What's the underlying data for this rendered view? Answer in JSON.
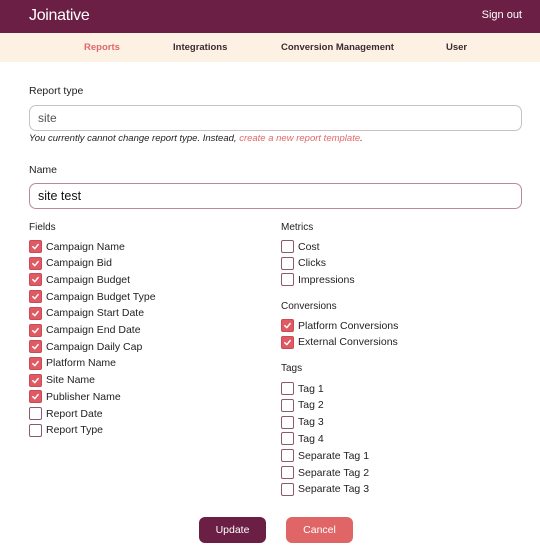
{
  "header": {
    "brand": "Joinative",
    "signout": "Sign out"
  },
  "nav": {
    "items": [
      {
        "label": "Reports",
        "active": true
      },
      {
        "label": "Integrations",
        "active": false
      },
      {
        "label": "Conversion Management",
        "active": false
      },
      {
        "label": "User",
        "active": false
      }
    ]
  },
  "form": {
    "report_type_label": "Report type",
    "report_type_value": "site",
    "hint_text": "You currently cannot change report type. Instead, ",
    "hint_link": "create a new report template",
    "hint_end": ".",
    "name_label": "Name",
    "name_value": "site test"
  },
  "fields": {
    "title": "Fields",
    "items": [
      {
        "label": "Campaign Name",
        "checked": true
      },
      {
        "label": "Campaign Bid",
        "checked": true
      },
      {
        "label": "Campaign Budget",
        "checked": true
      },
      {
        "label": "Campaign Budget Type",
        "checked": true
      },
      {
        "label": "Campaign Start Date",
        "checked": true
      },
      {
        "label": "Campaign End Date",
        "checked": true
      },
      {
        "label": "Campaign Daily Cap",
        "checked": true
      },
      {
        "label": "Platform Name",
        "checked": true
      },
      {
        "label": "Site Name",
        "checked": true
      },
      {
        "label": "Publisher Name",
        "checked": true
      },
      {
        "label": "Report Date",
        "checked": false
      },
      {
        "label": "Report Type",
        "checked": false
      }
    ]
  },
  "metrics": {
    "title": "Metrics",
    "items": [
      {
        "label": "Cost",
        "checked": false
      },
      {
        "label": "Clicks",
        "checked": false
      },
      {
        "label": "Impressions",
        "checked": false
      }
    ]
  },
  "conversions": {
    "title": "Conversions",
    "items": [
      {
        "label": "Platform Conversions",
        "checked": true
      },
      {
        "label": "External Conversions",
        "checked": true
      }
    ]
  },
  "tags": {
    "title": "Tags",
    "items": [
      {
        "label": "Tag 1",
        "checked": false
      },
      {
        "label": "Tag 2",
        "checked": false
      },
      {
        "label": "Tag 3",
        "checked": false
      },
      {
        "label": "Tag 4",
        "checked": false
      },
      {
        "label": "Separate Tag 1",
        "checked": false
      },
      {
        "label": "Separate Tag 2",
        "checked": false
      },
      {
        "label": "Separate Tag 3",
        "checked": false
      }
    ]
  },
  "actions": {
    "update": "Update",
    "cancel": "Cancel"
  },
  "colors": {
    "brand": "#6b1f45",
    "accent": "#e0686a",
    "nav_bg": "#fdf1e3"
  }
}
